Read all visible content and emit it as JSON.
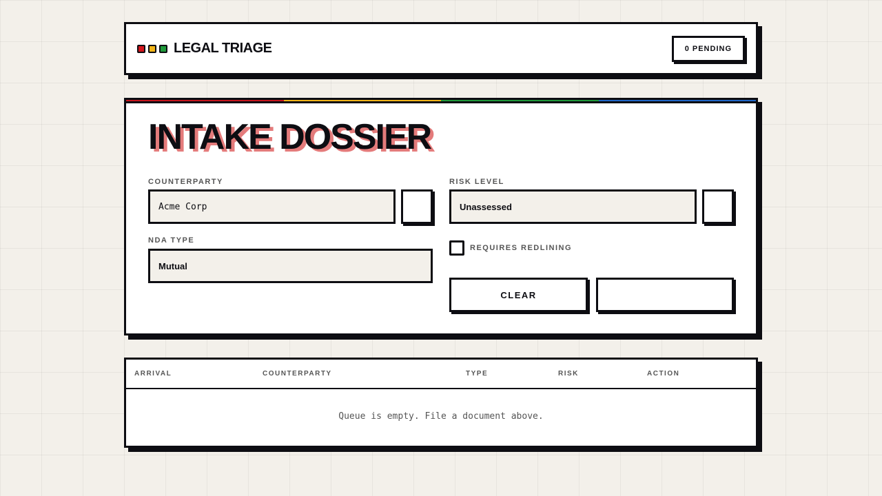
{
  "header": {
    "title": "LEGAL TRIAGE",
    "pending_label": "0 PENDING",
    "dots": [
      {
        "name": "red",
        "color": "#d4161c"
      },
      {
        "name": "yellow",
        "color": "#f2b418"
      },
      {
        "name": "green",
        "color": "#1f9a3a"
      }
    ]
  },
  "intake": {
    "accent_stripe": [
      "#c8161c",
      "#f2b418",
      "#1f9a3a",
      "#1f66c8"
    ],
    "title": "INTAKE DOSSIER",
    "title_shadow_color": "#e47b7b",
    "counterparty": {
      "label": "COUNTERPARTY",
      "value": "Acme Corp"
    },
    "risk_level": {
      "label": "RISK LEVEL",
      "value": "Unassessed"
    },
    "nda_type": {
      "label": "NDA TYPE",
      "value": "Mutual"
    },
    "redlining": {
      "label": "REQUIRES REDLINING",
      "checked": false
    },
    "clear_label": "CLEAR",
    "submit_label": ""
  },
  "queue": {
    "columns": [
      "ARRIVAL",
      "COUNTERPARTY",
      "TYPE",
      "RISK",
      "ACTION"
    ],
    "rows": [],
    "empty_message": "Queue is empty. File a document above."
  },
  "colors": {
    "background": "#f3f0ea",
    "ink": "#0d0d12",
    "field_fill": "#f3f0ea"
  }
}
